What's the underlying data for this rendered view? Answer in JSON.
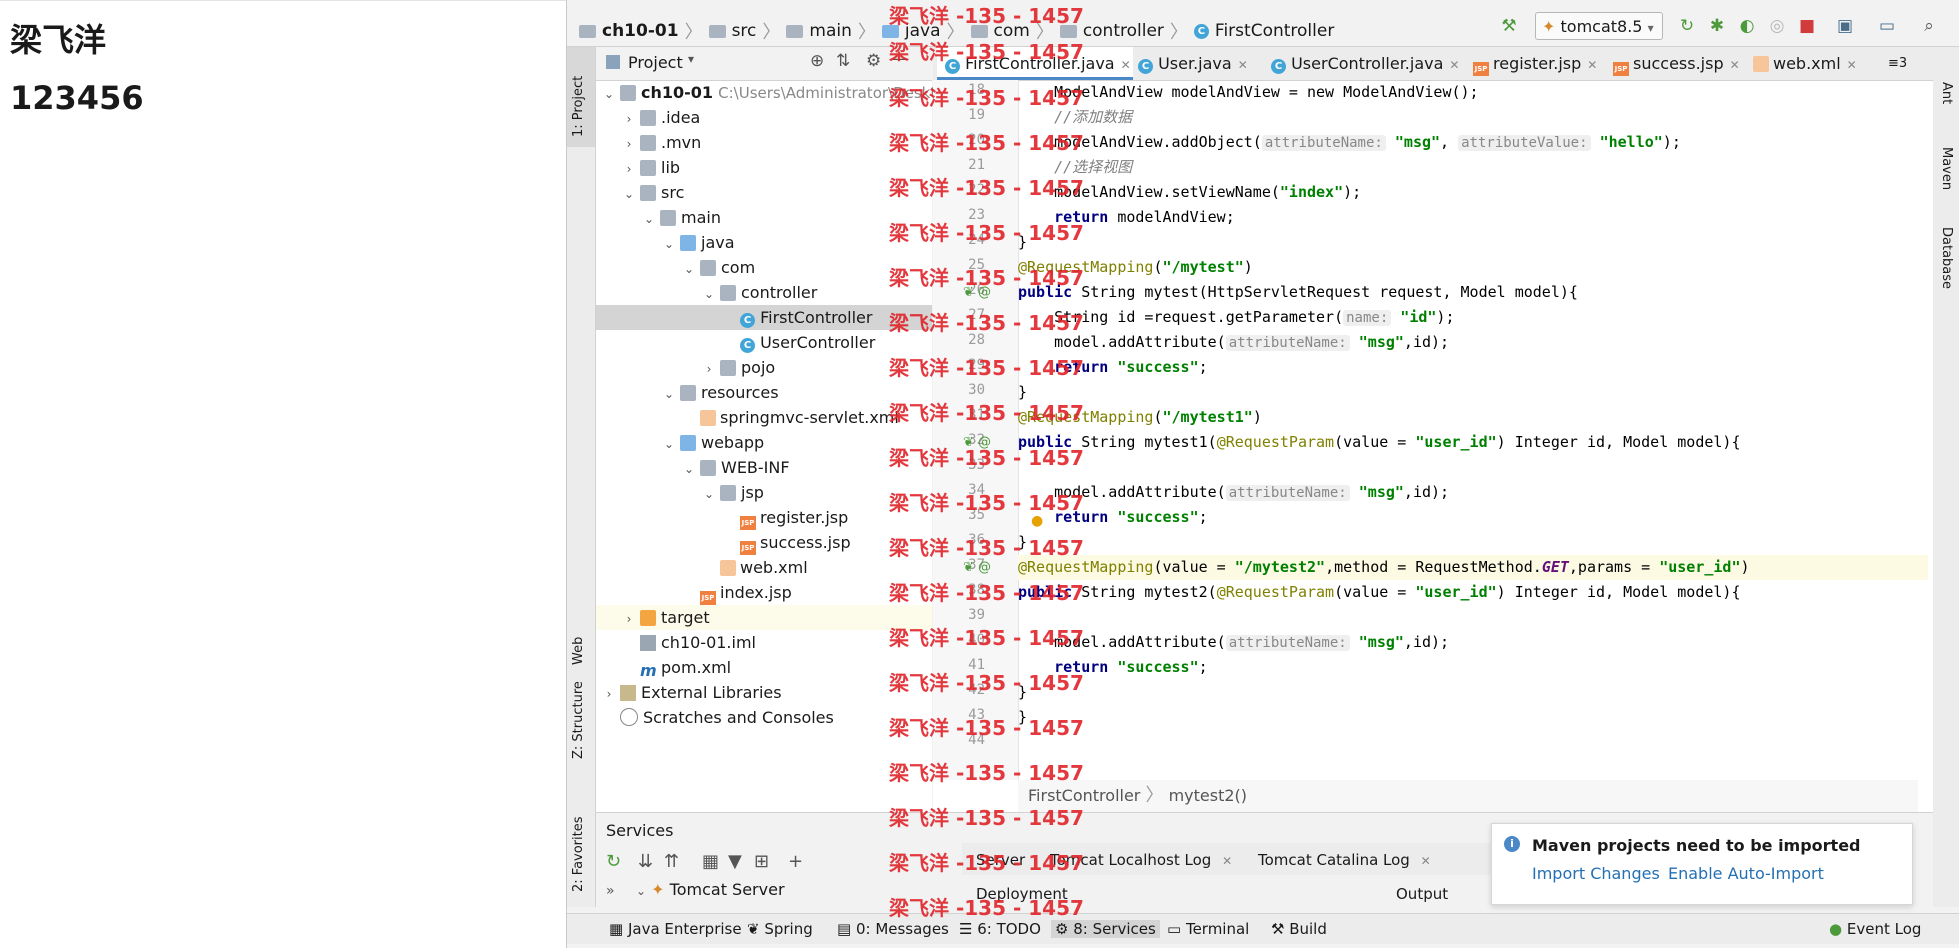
{
  "browser_page": {
    "name": "梁飞洋",
    "value": "123456"
  },
  "nav_bar": {
    "crumbs": [
      "ch10-01",
      "src",
      "main",
      "java",
      "com",
      "controller",
      "FirstController"
    ],
    "run_config": "tomcat8.5"
  },
  "project_panel": {
    "title": "Project",
    "root_name": "ch10-01",
    "root_path": "C:\\Users\\Administrator\\Deskt",
    "tree": [
      {
        "label": ".idea"
      },
      {
        "label": ".mvn"
      },
      {
        "label": "lib"
      },
      {
        "label": "src"
      },
      {
        "label": "main"
      },
      {
        "label": "java"
      },
      {
        "label": "com"
      },
      {
        "label": "controller"
      },
      {
        "label": "FirstController"
      },
      {
        "label": "UserController"
      },
      {
        "label": "pojo"
      },
      {
        "label": "resources"
      },
      {
        "label": "springmvc-servlet.xml"
      },
      {
        "label": "webapp"
      },
      {
        "label": "WEB-INF"
      },
      {
        "label": "jsp"
      },
      {
        "label": "register.jsp"
      },
      {
        "label": "success.jsp"
      },
      {
        "label": "web.xml"
      },
      {
        "label": "index.jsp"
      },
      {
        "label": "target"
      },
      {
        "label": "ch10-01.iml"
      },
      {
        "label": "pom.xml"
      },
      {
        "label": "External Libraries"
      },
      {
        "label": "Scratches and Consoles"
      }
    ]
  },
  "editor_tabs": [
    "FirstController.java",
    "User.java",
    "UserController.java",
    "register.jsp",
    "success.jsp",
    "web.xml"
  ],
  "tab_overflow": "≡3",
  "code": {
    "line_numbers": [
      "18",
      "19",
      "20",
      "21",
      "22",
      "23",
      "24",
      "25",
      "26",
      "27",
      "28",
      "29",
      "30",
      "31",
      "32",
      "33",
      "34",
      "35",
      "36",
      "37",
      "38",
      "39",
      "40",
      "41",
      "42",
      "43",
      "44"
    ],
    "l18": "    ModelAndView modelAndView = new ModelAndView();",
    "l19": "    //添加数据",
    "l20a": "    modelAndView.addObject(",
    "l20hint1": "attributeName:",
    "l20s1": "\"msg\"",
    "l20hint2": "attributeValue:",
    "l20s2": "\"hello\"",
    "l20end": ");",
    "l21": "    //选择视图",
    "l22a": "    modelAndView.setViewName(",
    "l22s": "\"index\"",
    "l22end": ");",
    "l23kw": "return",
    "l23rest": " modelAndView;",
    "l24": "}",
    "l25an": "@RequestMapping",
    "l25s": "\"/mytest\"",
    "l26": " String mytest(HttpServletRequest request, Model model){",
    "l27a": "    String id =request.getParameter(",
    "l27hint": "name:",
    "l27s": "\"id\"",
    "l27end": ");",
    "l28a": "    model.addAttribute(",
    "l28hint": "attributeName:",
    "l28s": "\"msg\"",
    "l28end": ",id);",
    "l29s": "\"success\"",
    "l31s": "\"/mytest1\"",
    "l32a": " String mytest1(",
    "l32an": "@RequestParam",
    "l32b": "(value = ",
    "l32s": "\"user_id\"",
    "l32end": ") Integer id, Model model){",
    "l37a": "(value = ",
    "l37s": "\"/mytest2\"",
    "l37b": ",method = RequestMethod.",
    "l37get": "GET",
    "l37c": ",params = ",
    "l37s2": "\"user_id\"",
    "l37end": ")",
    "l38a": " String mytest2(",
    "kw_public": "public",
    "semi": ";",
    "open_paren": "(",
    "close_paren": ")",
    "comma": ","
  },
  "editor_breadcrumb": [
    "FirstController",
    "mytest2()"
  ],
  "services": {
    "title": "Services",
    "tree_item": "Tomcat Server",
    "tabs": [
      "Server",
      "Tomcat Localhost Log",
      "Tomcat Catalina Log"
    ],
    "deployment": "Deployment",
    "output": "Output"
  },
  "notification": {
    "title": "Maven projects need to be imported",
    "action1": "Import Changes",
    "action2": "Enable Auto-Import"
  },
  "left_tool_windows": [
    "1: Project",
    "Web",
    "Z: Structure",
    "2: Favorites"
  ],
  "right_tool_windows": [
    "Ant",
    "Maven",
    "Database"
  ],
  "bottom_tools": [
    "Java Enterprise",
    "Spring",
    "0: Messages",
    "6: TODO",
    "8: Services",
    "Terminal",
    "Build",
    "Event Log"
  ],
  "watermark": "梁飞洋 -135 - 1457",
  "colors": {
    "accent": "#4a88c7",
    "watermark": "#e0242a",
    "keyword": "#000080",
    "string": "#008000",
    "annotation": "#808000"
  }
}
